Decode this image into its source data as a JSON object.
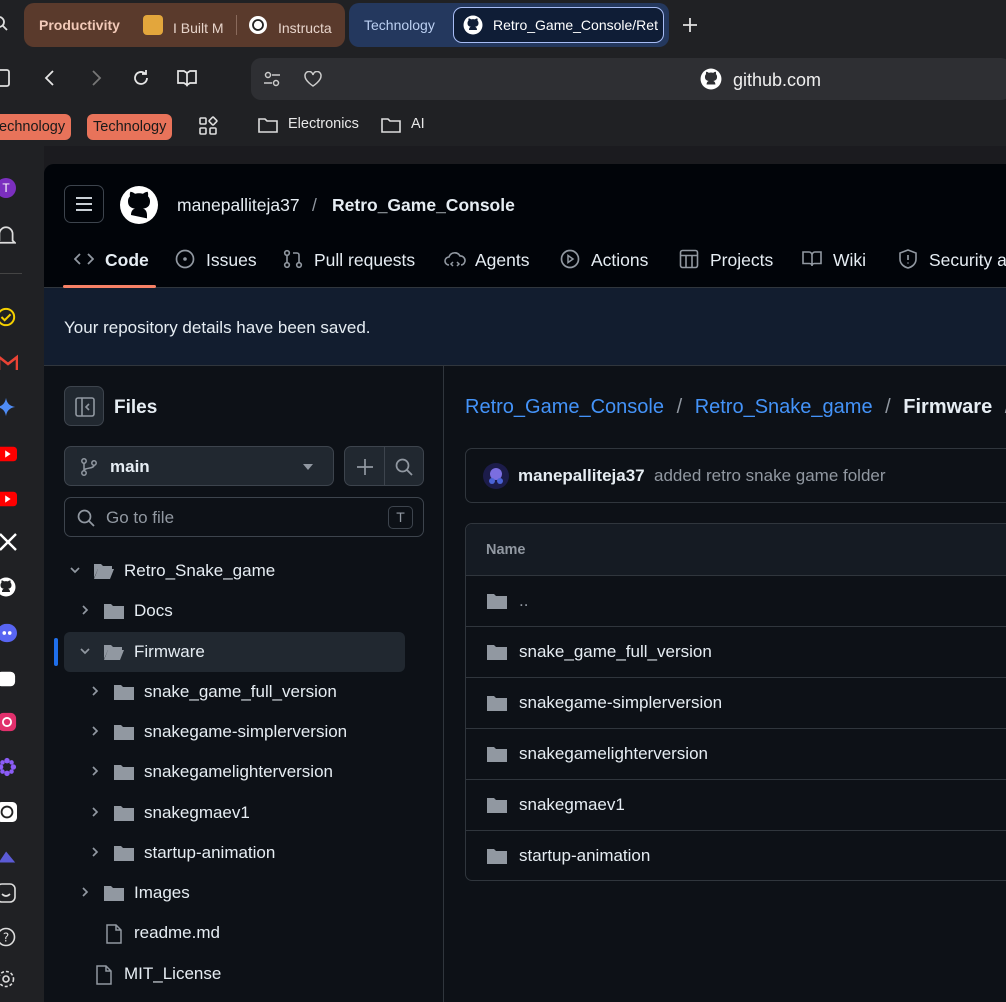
{
  "browser": {
    "tab_groups": [
      {
        "label": "Productivity",
        "tabs": [
          "I Built M",
          "Instructa"
        ]
      },
      {
        "label": "Technology",
        "tabs": [
          "Retro_Game_Console/Ret"
        ]
      }
    ],
    "new_tab_icon": "plus-icon",
    "url": "github.com",
    "bookmarks": {
      "pills": [
        "echnology",
        "Technology"
      ],
      "folders": [
        "Electronics",
        "AI"
      ]
    },
    "colors": {
      "productivity_group": "#5a3a2c",
      "technology_group": "#24385e",
      "bookmark_pill": "#e8735a"
    }
  },
  "github": {
    "owner": "manepalliteja37",
    "separator": "/",
    "repo": "Retro_Game_Console",
    "nav": [
      {
        "label": "Code",
        "icon": "code-icon"
      },
      {
        "label": "Issues",
        "icon": "issue-icon"
      },
      {
        "label": "Pull requests",
        "icon": "pull-request-icon"
      },
      {
        "label": "Agents",
        "icon": "agents-icon"
      },
      {
        "label": "Actions",
        "icon": "play-icon"
      },
      {
        "label": "Projects",
        "icon": "table-icon"
      },
      {
        "label": "Wiki",
        "icon": "book-icon"
      },
      {
        "label": "Security a",
        "icon": "shield-icon"
      }
    ],
    "flash": "Your repository details have been saved.",
    "sidebar": {
      "title": "Files",
      "branch": "main",
      "search_placeholder": "Go to file",
      "shortcut": "T",
      "tree": [
        {
          "label": "Retro_Snake_game",
          "expanded": true
        },
        {
          "label": "Docs"
        },
        {
          "label": "Firmware",
          "expanded": true,
          "selected": true
        },
        {
          "label": "snake_game_full_version"
        },
        {
          "label": "snakegame-simplerversion"
        },
        {
          "label": "snakegamelighterversion"
        },
        {
          "label": "snakegmaev1"
        },
        {
          "label": "startup-animation"
        },
        {
          "label": "Images"
        },
        {
          "label": "readme.md"
        },
        {
          "label": "MIT_License"
        }
      ]
    },
    "breadcrumb": {
      "parts": [
        "Retro_Game_Console",
        "Retro_Snake_game"
      ],
      "current": "Firmware",
      "sep": "/"
    },
    "commit": {
      "author": "manepalliteja37",
      "message": "added retro snake game folder"
    },
    "table": {
      "header": "Name",
      "rows": [
        "..",
        "snake_game_full_version",
        "snakegame-simplerversion",
        "snakegamelighterversion",
        "snakegmaev1",
        "startup-animation"
      ]
    },
    "colors": {
      "link": "#4493f8",
      "accent_underline": "#f78166",
      "selected_bar": "#1f6feb"
    }
  }
}
